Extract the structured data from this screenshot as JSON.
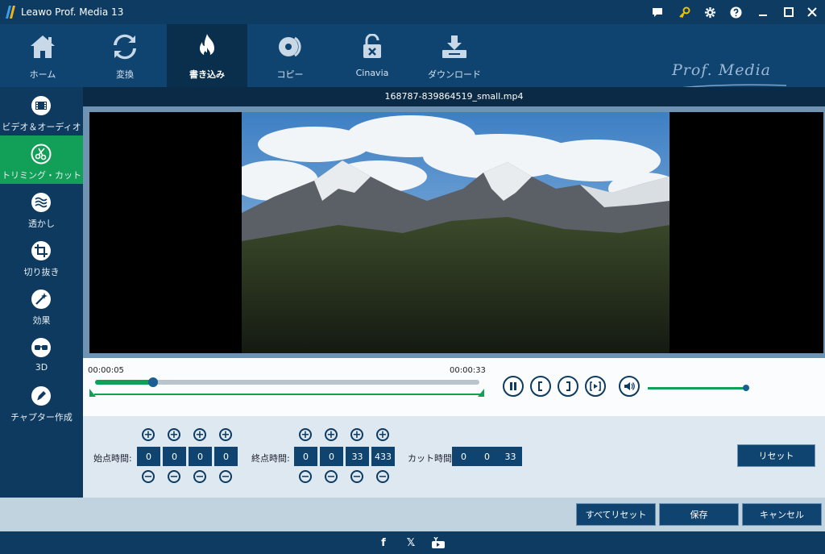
{
  "app": {
    "title": "Leawo Prof. Media 13"
  },
  "brand": {
    "text": "Prof. Media"
  },
  "topnav": {
    "items": [
      {
        "label": "ホーム",
        "icon": "home-icon"
      },
      {
        "label": "変換",
        "icon": "refresh-icon"
      },
      {
        "label": "書き込み",
        "icon": "flame-icon"
      },
      {
        "label": "コピー",
        "icon": "disc-icon"
      },
      {
        "label": "Cinavia",
        "icon": "unlock-icon"
      },
      {
        "label": "ダウンロード",
        "icon": "download-icon"
      }
    ],
    "active_index": 2
  },
  "sidebar": {
    "items": [
      {
        "label": "ビデオ＆オーディオ",
        "icon": "film-icon"
      },
      {
        "label": "トリミング・カット",
        "icon": "scissors-icon"
      },
      {
        "label": "透かし",
        "icon": "watermark-icon"
      },
      {
        "label": "切り抜き",
        "icon": "crop-icon"
      },
      {
        "label": "効果",
        "icon": "effect-icon"
      },
      {
        "label": "3D",
        "icon": "3d-glasses-icon"
      },
      {
        "label": "チャプター作成",
        "icon": "chapter-icon"
      }
    ],
    "active_index": 1
  },
  "video": {
    "file_name": "168787-839864519_small.mp4"
  },
  "timeline": {
    "current_time": "00:00:05",
    "total_time": "00:00:33",
    "progress": 0.15,
    "volume": 0.95
  },
  "trim": {
    "start_label": "始点時間:",
    "start_values": [
      "0",
      "0",
      "0",
      "0"
    ],
    "end_label": "終点時間:",
    "end_values": [
      "0",
      "0",
      "33",
      "433"
    ],
    "cut_label": "カット時間:",
    "cut_values": [
      "0",
      "0",
      "33"
    ],
    "plus_symbol": "+",
    "minus_symbol": "−",
    "reset_label": "リセット"
  },
  "actions": {
    "reset_all_label": "すべてリセット",
    "save_label": "保存",
    "cancel_label": "キャンセル"
  },
  "footer": {
    "facebook_glyph": "f",
    "x_glyph": "𝕏"
  },
  "colors": {
    "accent_green": "#12a058",
    "navy": "#0f4470",
    "dark_navy": "#0a2f4d"
  }
}
